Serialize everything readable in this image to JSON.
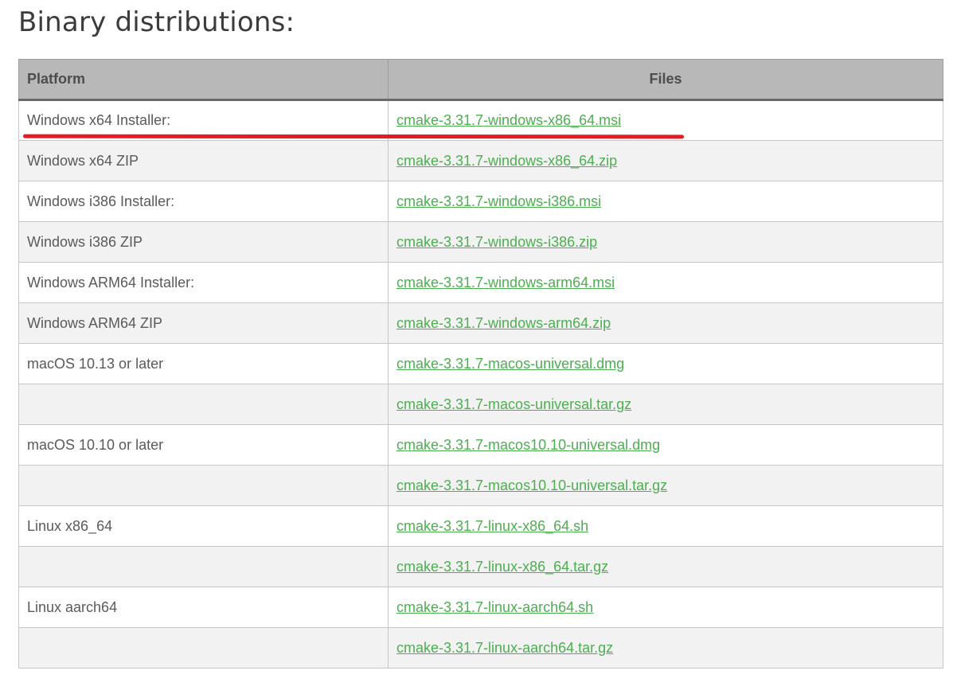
{
  "page": {
    "title": "Binary distributions:"
  },
  "table": {
    "headers": {
      "platform": "Platform",
      "files": "Files"
    },
    "rows": [
      {
        "platform": "Windows x64 Installer:",
        "file": "cmake-3.31.7-windows-x86_64.msi"
      },
      {
        "platform": "Windows x64 ZIP",
        "file": "cmake-3.31.7-windows-x86_64.zip"
      },
      {
        "platform": "Windows i386 Installer:",
        "file": "cmake-3.31.7-windows-i386.msi"
      },
      {
        "platform": "Windows i386 ZIP",
        "file": "cmake-3.31.7-windows-i386.zip"
      },
      {
        "platform": "Windows ARM64 Installer:",
        "file": "cmake-3.31.7-windows-arm64.msi"
      },
      {
        "platform": "Windows ARM64 ZIP",
        "file": "cmake-3.31.7-windows-arm64.zip"
      },
      {
        "platform": "macOS 10.13 or later",
        "file": "cmake-3.31.7-macos-universal.dmg"
      },
      {
        "platform": "",
        "file": "cmake-3.31.7-macos-universal.tar.gz"
      },
      {
        "platform": "macOS 10.10 or later",
        "file": "cmake-3.31.7-macos10.10-universal.dmg"
      },
      {
        "platform": "",
        "file": "cmake-3.31.7-macos10.10-universal.tar.gz"
      },
      {
        "platform": "Linux x86_64",
        "file": "cmake-3.31.7-linux-x86_64.sh"
      },
      {
        "platform": "",
        "file": "cmake-3.31.7-linux-x86_64.tar.gz"
      },
      {
        "platform": "Linux aarch64",
        "file": "cmake-3.31.7-linux-aarch64.sh"
      },
      {
        "platform": "",
        "file": "cmake-3.31.7-linux-aarch64.tar.gz"
      }
    ]
  },
  "colors": {
    "link": "#4caf50",
    "header_bg": "#b8b8b8",
    "stripe_bg": "#f2f2f2",
    "annotation": "#e51c23"
  },
  "annotation": {
    "highlighted_row": "Windows x64 Installer:"
  }
}
